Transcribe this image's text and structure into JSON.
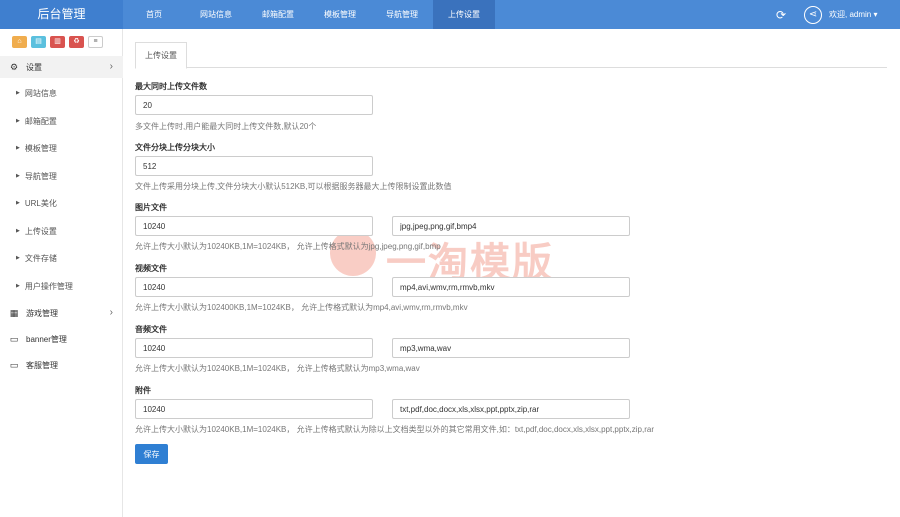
{
  "brand": "后台管理",
  "nav": [
    "首页",
    "网站信息",
    "邮箱配置",
    "模板管理",
    "导航管理",
    "上传设置"
  ],
  "nav_active": 5,
  "user": "欢迎, admin ▾",
  "quick_icons": [
    "home-icon",
    "file-icon",
    "trash-icon",
    "recycle-icon",
    "list-icon"
  ],
  "sidebar": {
    "settings": "设置",
    "settings_items": [
      "网站信息",
      "邮箱配置",
      "模板管理",
      "导航管理",
      "URL美化",
      "上传设置",
      "文件存储",
      "用户操作管理"
    ],
    "game": "游戏管理",
    "banner": "banner管理",
    "service": "客服管理"
  },
  "tab": "上传设置",
  "form": {
    "max_files": {
      "label": "最大同时上传文件数",
      "value": "20",
      "hint": "多文件上传时,用户能最大同时上传文件数,默认20个"
    },
    "chunk": {
      "label": "文件分块上传分块大小",
      "value": "512",
      "hint": "文件上传采用分块上传,文件分块大小默认512KB,可以根据服务器最大上传限制设置此数值"
    },
    "image": {
      "label": "图片文件",
      "size": "10240",
      "types": "jpg,jpeg,png,gif,bmp4",
      "hint": "允许上传大小默认为10240KB,1M=1024KB， 允许上传格式默认为jpg,jpeg,png,gif,bmp"
    },
    "video": {
      "label": "视频文件",
      "size": "10240",
      "types": "mp4,avi,wmv,rm,rmvb,mkv",
      "hint": "允许上传大小默认为102400KB,1M=1024KB， 允许上传格式默认为mp4,avi,wmv,rm,rmvb,mkv"
    },
    "audio": {
      "label": "音频文件",
      "size": "10240",
      "types": "mp3,wma,wav",
      "hint": "允许上传大小默认为10240KB,1M=1024KB， 允许上传格式默认为mp3,wma,wav"
    },
    "attach": {
      "label": "附件",
      "size": "10240",
      "types": "txt,pdf,doc,docx,xls,xlsx,ppt,pptx,zip,rar",
      "hint": "允许上传大小默认为10240KB,1M=1024KB， 允许上传格式默认为除以上文档类型以外的其它常用文件,如：txt,pdf,doc,docx,xls,xlsx,ppt,pptx,zip,rar"
    }
  },
  "save": "保存",
  "watermark": "一淘模版"
}
